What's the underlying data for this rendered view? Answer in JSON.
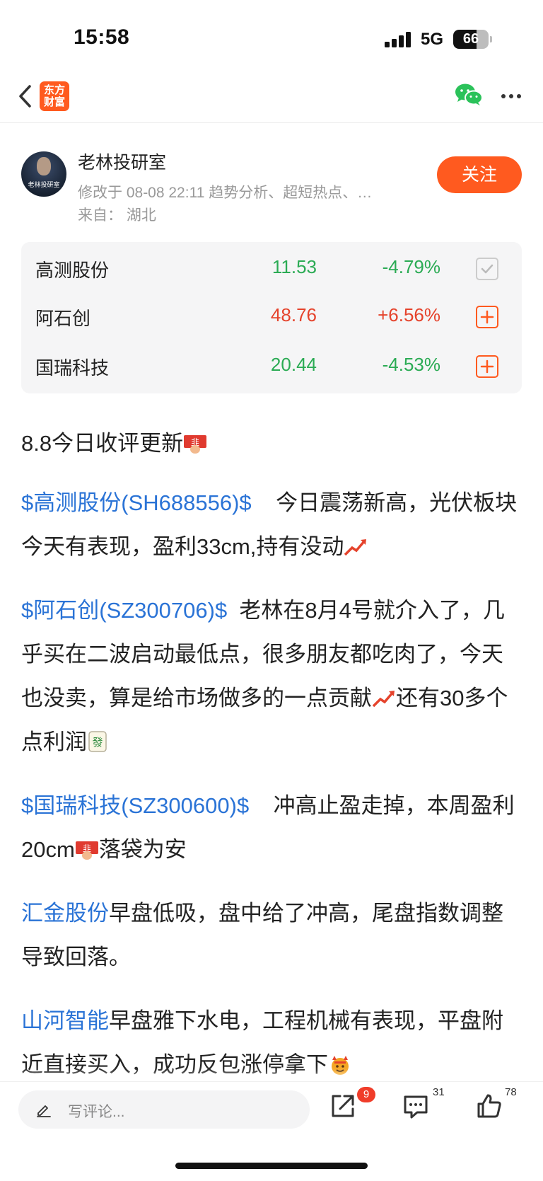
{
  "status_bar": {
    "time": "15:58",
    "network": "5G",
    "battery": "66",
    "battery_level": 0.66
  },
  "nav": {
    "back_icon": "chevron-left-icon",
    "logo_line1": "东方",
    "logo_line2": "财富",
    "share_icon": "wechat-icon",
    "more_icon": "more-horizontal-icon",
    "accent": "#ff5a1f"
  },
  "author": {
    "avatar_text": "老林投研室",
    "name": "老林投研室",
    "meta": "修改于 08-08 22:11 趋势分析、超短热点、…",
    "from": "来自：  湖北",
    "follow_label": "关注"
  },
  "stocks": [
    {
      "name": "高测股份",
      "price": "11.53",
      "change": "-4.79%",
      "direction": "down",
      "in_watchlist": true,
      "icon": "check-square-icon"
    },
    {
      "name": "阿石创",
      "price": "48.76",
      "change": "+6.56%",
      "direction": "up",
      "in_watchlist": false,
      "icon": "plus-square-icon"
    },
    {
      "name": "国瑞科技",
      "price": "20.44",
      "change": "-4.53%",
      "direction": "down",
      "in_watchlist": false,
      "icon": "plus-square-icon"
    }
  ],
  "colors": {
    "up": "#e5432c",
    "down": "#2bab54",
    "link": "#2a73d6"
  },
  "article": {
    "p1": "8.8今日收评更新",
    "p2_link": "$高测股份(SH688556)$",
    "p2_text": "    今日震荡新高，光伏板块今天有表现，盈利33cm,持有没动",
    "p3_link": "$阿石创(SZ300706)$",
    "p3_text": "  老林在8月4号就介入了，几乎买在二波启动最低点，很多朋友都吃肉了，今天也没卖，算是给市场做多的一点贡献",
    "p3_text2": "还有30多个点利润",
    "p4_link": "$国瑞科技(SZ300600)$",
    "p4_text": "    冲高止盈走掉，本周盈利20cm",
    "p4_text2": "落袋为安",
    "p5_link": "汇金股份",
    "p5_text": "早盘低吸，盘中给了冲高，尾盘指数调整导致回落。",
    "p6_link": "山河智能",
    "p6_text": "早盘雅下水电，工程机械有表现，平盘附近直接买入，成功反包涨停拿下",
    "emojis": [
      "money-emoji",
      "trend-up-emoji",
      "mahjong-fa-emoji",
      "devil-emoji"
    ]
  },
  "bottom_bar": {
    "comment_placeholder": "写评论...",
    "share_badge": "9",
    "comment_count": "31",
    "like_count": "78",
    "icons": [
      "pencil-icon",
      "share-icon",
      "comment-icon",
      "thumbs-up-icon"
    ]
  }
}
